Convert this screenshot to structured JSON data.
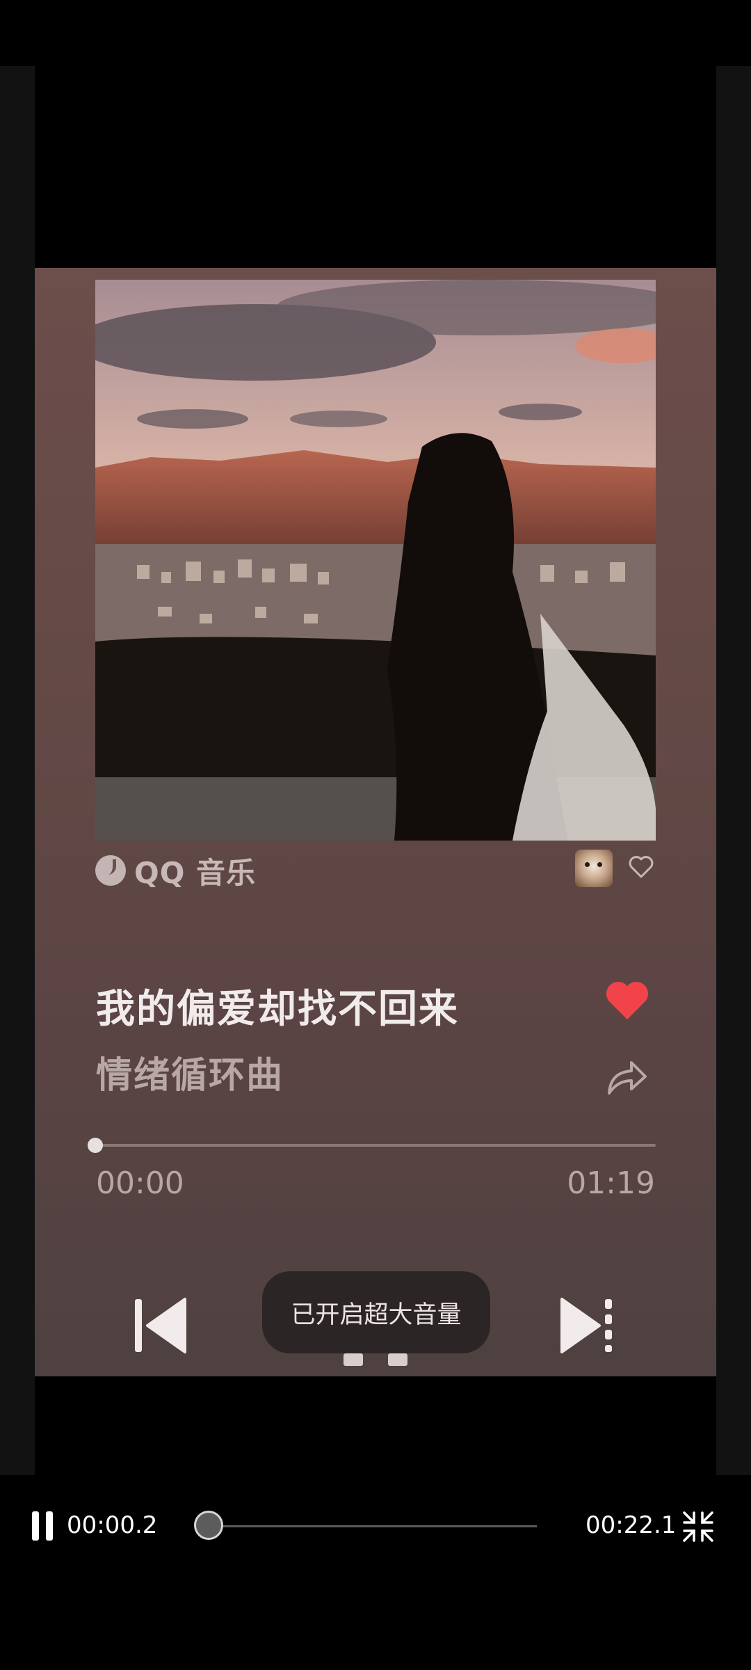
{
  "brand": {
    "name": "QQ 音乐"
  },
  "song": {
    "title": "我的偏爱却找不回来",
    "subtitle": "情绪循环曲"
  },
  "progress": {
    "current": "00:00",
    "total": "01:19",
    "fraction": 0.0
  },
  "toast": {
    "text": "已开启超大音量"
  },
  "video_player": {
    "current_time": "00:00.2",
    "duration": "00:22.1",
    "fraction": 0.009
  },
  "colors": {
    "like": "#f2434a",
    "frame_bg": "#634946"
  },
  "icons": {
    "brand": "qq-music-icon",
    "favorite_small": "heart-outline-icon",
    "like": "heart-filled-icon",
    "share": "share-icon",
    "previous": "skip-previous-icon",
    "next": "skip-next-icon",
    "play_state": "pause-icon",
    "exit_fullscreen": "exit-fullscreen-icon"
  }
}
